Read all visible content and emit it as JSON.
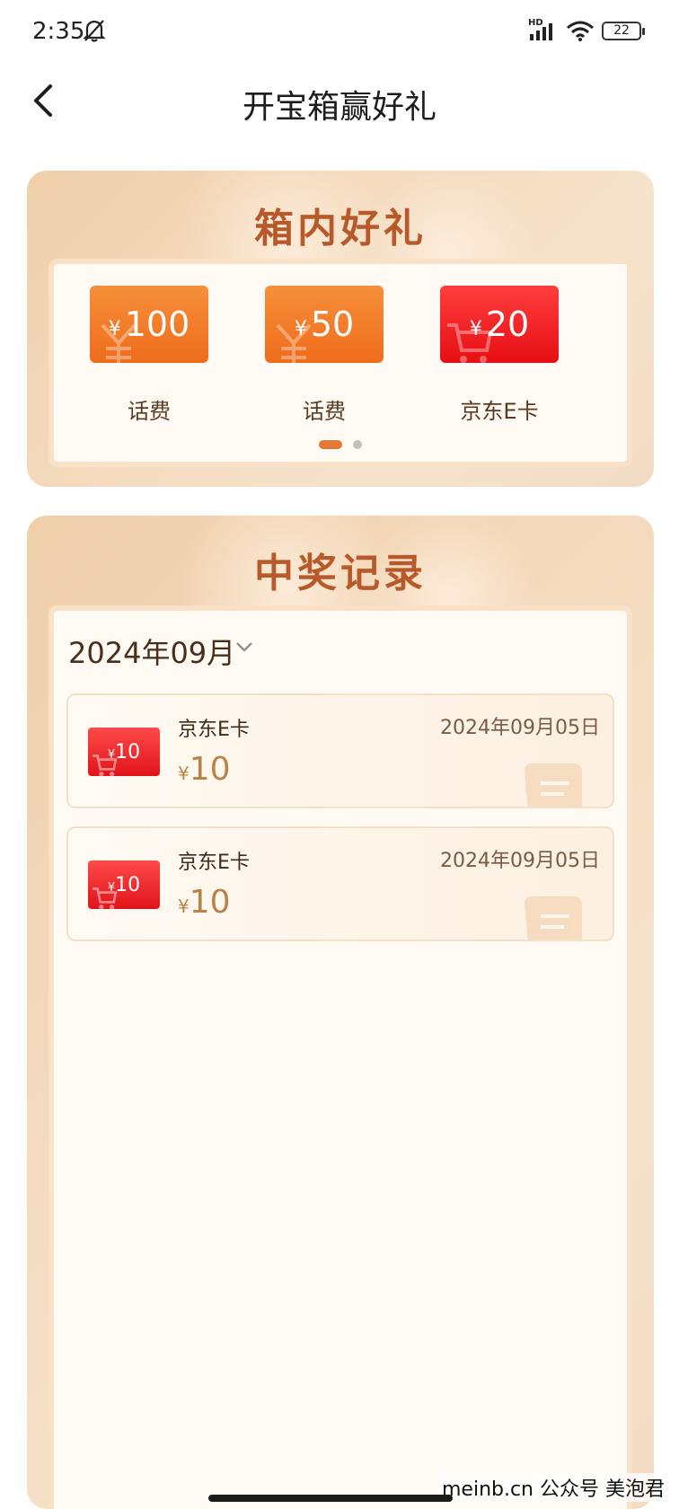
{
  "status_bar": {
    "time": "2:35",
    "battery": "22",
    "hd_label": "HD",
    "icons": [
      "bell-off-icon",
      "signal-icon",
      "wifi-icon",
      "battery-icon"
    ]
  },
  "header": {
    "title": "开宝箱赢好礼",
    "back_icon": "chevron-left-icon"
  },
  "prizes_panel": {
    "title": "箱内好礼",
    "items": [
      {
        "currency": "¥",
        "amount": "100",
        "label": "话费",
        "color": "#f07a25"
      },
      {
        "currency": "¥",
        "amount": "50",
        "label": "话费",
        "color": "#f07a25"
      },
      {
        "currency": "¥",
        "amount": "20",
        "label": "京东E卡",
        "color": "#ea1a1e"
      }
    ],
    "pagination": {
      "current": 1,
      "total": 2
    }
  },
  "records_panel": {
    "title": "中奖记录",
    "month": "2024年09月",
    "records": [
      {
        "thumb_currency": "¥",
        "thumb_amount": "10",
        "name": "京东E卡",
        "currency": "¥",
        "amount": "10",
        "date": "2024年09月05日"
      },
      {
        "thumb_currency": "¥",
        "thumb_amount": "10",
        "name": "京东E卡",
        "currency": "¥",
        "amount": "10",
        "date": "2024年09月05日"
      }
    ]
  },
  "watermark": "meinb.cn  公众号 美泡君",
  "colors": {
    "accent": "#b8592a",
    "panel_bg": "#f4dcc0",
    "orange_card": "#f07a25",
    "red_card": "#ea1a1e"
  }
}
